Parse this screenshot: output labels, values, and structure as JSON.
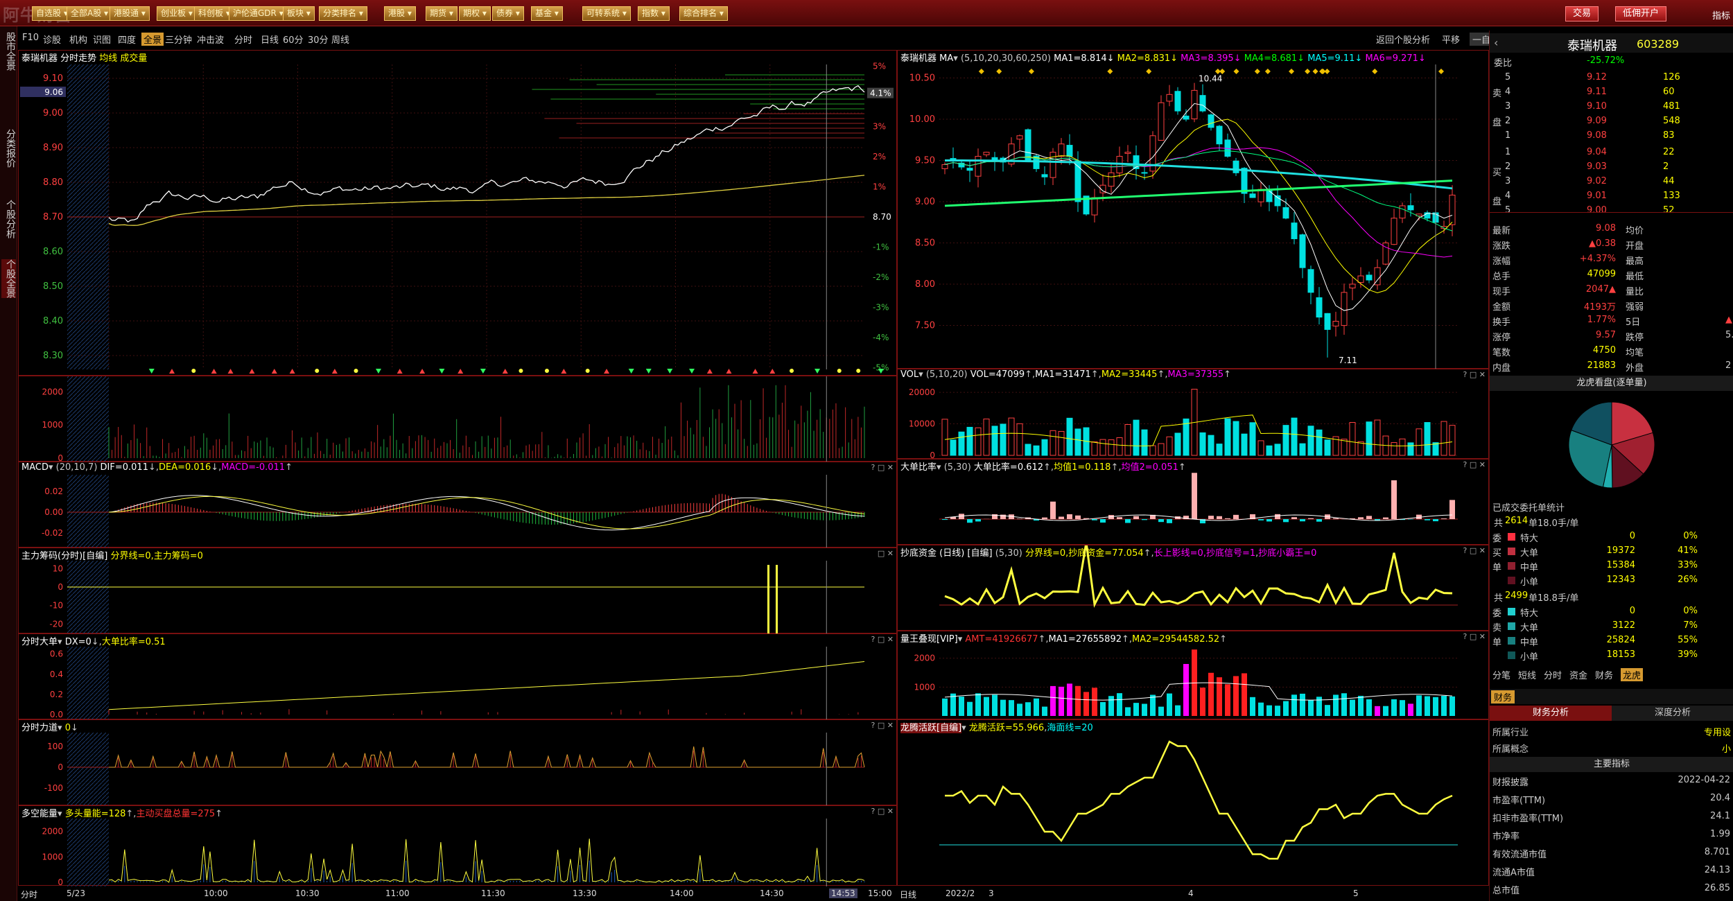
{
  "top": {
    "watermark": "阿牛财富",
    "menu": [
      "自选股",
      "全部A股",
      "港股通",
      "创业板",
      "科创板",
      "沪伦通GDR",
      "板块",
      "分类排名",
      "港股",
      "期货",
      "期权",
      "债券",
      "基金",
      "可转系统",
      "指数",
      "综合排名"
    ],
    "right_buttons": [
      "交易",
      "低佣开户"
    ],
    "right_edge_label": "指标"
  },
  "left_tabs": [
    "股市全景",
    "分类报价",
    "个股分析",
    "个股全景"
  ],
  "toolbar": {
    "left": [
      "F10",
      "诊股",
      "机构",
      "识图",
      "四度",
      "全景",
      "三分钟",
      "冲击波",
      "分时",
      "日线",
      "60分",
      "30分",
      "周线"
    ],
    "active": "全景",
    "right": [
      "返回个股分析",
      "平移",
      "一自选"
    ]
  },
  "intraday": {
    "title": "泰瑞机器 分时走势",
    "title_extra": "均线 成交量",
    "y_labels": [
      "9.10",
      "9.06",
      "9.00",
      "8.90",
      "8.80",
      "8.70",
      "8.60",
      "8.50",
      "8.40",
      "8.30"
    ],
    "cursor_price": "9.06",
    "pct_labels": [
      "5%",
      "4.1%",
      "3%",
      "2%",
      "1%",
      "8.70",
      "-1%",
      "-2%",
      "-3%",
      "-4%",
      "-5%"
    ],
    "x_labels": [
      "分时",
      "5/23",
      "10:00",
      "10:30",
      "11:00",
      "11:30",
      "13:30",
      "14:00",
      "14:30",
      "14:53",
      "15:00"
    ],
    "vol_labels": [
      "2000",
      "1000",
      "0"
    ],
    "macd": {
      "title": "MACD",
      "params": "(20,10,7)",
      "dif": "DIF=0.011",
      "dea": "DEA=0.016",
      "macd": "MACD=-0.011",
      "labels": [
        "0.02",
        "0.00",
        "-0.02"
      ]
    },
    "zlcm": {
      "title": "主力筹码(分时)[自编]",
      "text": "分界线=0,主力筹码=0",
      "labels": [
        "10",
        "0",
        "-10",
        "-20"
      ]
    },
    "fsdd": {
      "title": "分时大单",
      "dx": "DX=0",
      "ratio": "大单比率=0.51",
      "labels": [
        "0.6",
        "0.4",
        "0.2",
        "0.0"
      ]
    },
    "fsld": {
      "title": "分时力道",
      "val": "0",
      "labels": [
        "100",
        "0",
        "-100"
      ]
    },
    "dknl": {
      "title": "多空能量",
      "a": "多头量能=128",
      "b": "主动买盘总量=275",
      "labels": [
        "2000",
        "1000",
        "0"
      ]
    }
  },
  "daily": {
    "title": "泰瑞机器",
    "ma_label": "MA",
    "ma_params": "(5,10,20,30,60,250)",
    "ma_values": [
      "MA1=8.814",
      "MA2=8.831",
      "MA3=8.395",
      "MA4=8.681",
      "MA5=9.11",
      "MA6=9.271"
    ],
    "y_labels": [
      "10.50",
      "10.00",
      "9.50",
      "9.00",
      "8.50",
      "8.00",
      "7.50"
    ],
    "high_mark": "10.44",
    "low_mark": "7.11",
    "x_labels": [
      "日线",
      "2022/2",
      "3",
      "4",
      "5"
    ],
    "vol": {
      "title": "VOL",
      "params": "(5,10,20)",
      "v": "VOL=47099",
      "ma1": "MA1=31471",
      "ma2": "MA2=33445",
      "ma3": "MA3=37355",
      "labels": [
        "20000",
        "10000",
        "0"
      ]
    },
    "ddbl": {
      "title": "大单比率",
      "params": "(5,30)",
      "a": "大单比率=0.612",
      "b": "均值1=0.118",
      "c": "均值2=0.051"
    },
    "cdzj": {
      "title": "抄底资金 (日线) [自编]",
      "params": "(5,30)",
      "text": "分界线=0,抄底资金=77.054",
      "t2": "长上影线=0,抄底信号=1",
      "t3": "抄底小霸王=0"
    },
    "lwdx": {
      "title": "量王叠现[VIP]",
      "amt": "AMT=41926677",
      "ma1": "MA1=27655892",
      "ma2": "MA2=29544582.52",
      "labels": [
        "2000",
        "1000"
      ]
    },
    "lthy": {
      "title": "龙腾活跃[自编]",
      "a": "龙腾活跃=55.966",
      "b": "海面线=20"
    }
  },
  "right": {
    "name": "泰瑞机器",
    "code": "603289",
    "weibi_label": "委比",
    "weibi": "-25.72%",
    "sell": [
      {
        "lv": "5",
        "p": "9.12",
        "v": "126"
      },
      {
        "lv": "4",
        "p": "9.11",
        "v": "60"
      },
      {
        "lv": "3",
        "p": "9.10",
        "v": "481"
      },
      {
        "lv": "2",
        "p": "9.09",
        "v": "548"
      },
      {
        "lv": "1",
        "p": "9.08",
        "v": "83"
      }
    ],
    "buy": [
      {
        "lv": "1",
        "p": "9.04",
        "v": "22"
      },
      {
        "lv": "2",
        "p": "9.03",
        "v": "2"
      },
      {
        "lv": "3",
        "p": "9.02",
        "v": "44"
      },
      {
        "lv": "4",
        "p": "9.01",
        "v": "133"
      },
      {
        "lv": "5",
        "p": "9.00",
        "v": "52"
      }
    ],
    "side_sell": "卖",
    "side_buy": "买",
    "side_pan": "盘",
    "stats": [
      {
        "k": "最新",
        "v": "9.08",
        "k2": "均价"
      },
      {
        "k": "涨跌",
        "v": "▲0.38",
        "k2": "开盘"
      },
      {
        "k": "涨幅",
        "v": "+4.37%",
        "k2": "最高"
      },
      {
        "k": "总手",
        "v": "47099",
        "k2": "最低"
      },
      {
        "k": "现手",
        "v": "2047▲",
        "k2": "量比"
      },
      {
        "k": "金额",
        "v": "4193万",
        "k2": "强弱"
      },
      {
        "k": "换手",
        "v": "1.77%",
        "k2": "5日"
      },
      {
        "k": "涨停",
        "v": "9.57",
        "k2": "跌停"
      },
      {
        "k": "笔数",
        "v": "4750",
        "k2": "均笔"
      },
      {
        "k": "内盘",
        "v": "21883",
        "k2": "外盘"
      }
    ],
    "stat_edges": [
      "▲",
      "5."
    ],
    "outer_edge": "2",
    "pie_title": "龙虎看盘(逐单量)",
    "pie": [
      41,
      33,
      26,
      7,
      55,
      39
    ],
    "orders_title": "已成交委托单统计",
    "sell_group": {
      "head_a": "共",
      "count": "2614",
      "head_b": "单18.0手/单",
      "side": [
        "委",
        "买",
        "单"
      ]
    },
    "sell_rows": [
      {
        "k": "特大",
        "v": "0",
        "p": "0%",
        "c": "#ff3040"
      },
      {
        "k": "大单",
        "v": "19372",
        "p": "41%",
        "c": "#c03040"
      },
      {
        "k": "中单",
        "v": "15384",
        "p": "33%",
        "c": "#902030"
      },
      {
        "k": "小单",
        "v": "12343",
        "p": "26%",
        "c": "#601020"
      }
    ],
    "buy_group": {
      "head_a": "共",
      "count": "2499",
      "head_b": "单18.8手/单",
      "side": [
        "委",
        "卖",
        "单"
      ]
    },
    "buy_rows": [
      {
        "k": "特大",
        "v": "0",
        "p": "0%",
        "c": "#20d0d0"
      },
      {
        "k": "大单",
        "v": "3122",
        "p": "7%",
        "c": "#20a8a8"
      },
      {
        "k": "中单",
        "v": "25824",
        "p": "55%",
        "c": "#188080"
      },
      {
        "k": "小单",
        "v": "18153",
        "p": "39%",
        "c": "#105858"
      }
    ],
    "tabs": [
      "分笔",
      "短线",
      "分时",
      "资金",
      "财务",
      "龙虎"
    ],
    "tab_active": "龙虎",
    "fin_tab": "财务",
    "fin_sub": [
      "财务分析",
      "深度分析"
    ],
    "industry_label": "所属行业",
    "industry": "专用设",
    "concept_label": "所属概念",
    "concept": "小",
    "main_idx": "主要指标",
    "fin_rows": [
      {
        "k": "财报披露",
        "v": "2022-04-22"
      },
      {
        "k": "市盈率(TTM)",
        "v": "20.4"
      },
      {
        "k": "扣非市盈率(TTM)",
        "v": "24.1"
      },
      {
        "k": "市净率",
        "v": "1.99"
      },
      {
        "k": "有效流通市值",
        "v": "8.701"
      },
      {
        "k": "流通A市值",
        "v": "24.13"
      },
      {
        "k": "总市值",
        "v": "26.85"
      }
    ]
  },
  "colors": {
    "up": "#ff3030",
    "down": "#00e0e0",
    "panel_border": "#7a1010",
    "yellow": "#ffff40",
    "orange_btn": "#d69a30"
  }
}
